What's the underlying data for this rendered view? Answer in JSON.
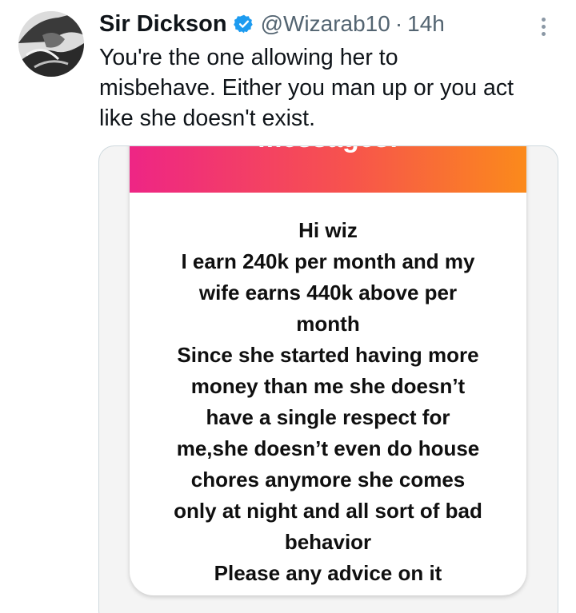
{
  "tweet": {
    "author_name": "Sir Dickson",
    "verified_icon": "verified-badge-icon",
    "handle": "@Wizarab10",
    "separator": "·",
    "time": "14h",
    "more_icon": "more-options-icon",
    "text_lines": [
      "You're the one allowing her to",
      "misbehave. Either you man up or you act",
      "like she doesn't exist."
    ]
  },
  "media": {
    "banner_text": "messages!",
    "message_lines": [
      "Hi wiz",
      "I earn 240k per month and my",
      "wife earns 440k above per",
      "month",
      "Since she started having more",
      "money than me she doesn’t",
      "have a single respect for",
      "me,she doesn’t even do house",
      "chores anymore she comes",
      "only at night and all sort of bad",
      "behavior",
      "Please any advice on it"
    ]
  },
  "colors": {
    "verified_blue": "#1d9bf0",
    "secondary_text": "#536471",
    "gradient_start": "#ee2585",
    "gradient_end": "#fb8a1b"
  }
}
